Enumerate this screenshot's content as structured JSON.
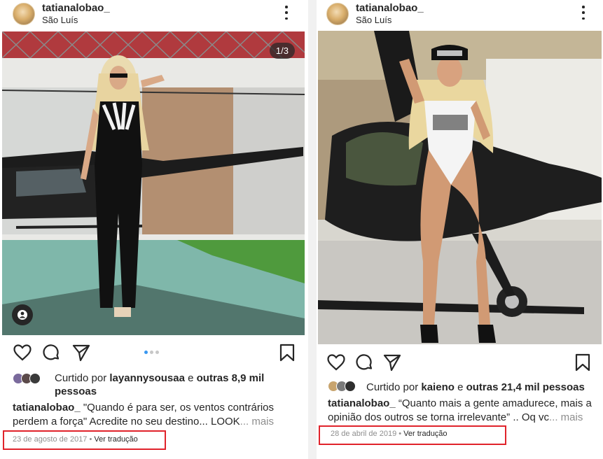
{
  "posts": [
    {
      "username": "tatianalobao_",
      "location": "São Luís",
      "image_counter": "1/3",
      "liked_by_prefix": "Curtido por",
      "liked_by_user": "layannysousaa",
      "liked_by_conj": "e",
      "liked_by_others": "outras 8,9 mil pessoas",
      "caption_user": "tatianalobao_",
      "caption_text": "\"Quando é para ser, os ventos contrários perdem a força\" Acredite no seu destino... LOOK",
      "caption_more": "... mais",
      "date": "23 de agosto de 2017",
      "separator": "•",
      "translate": "Ver tradução",
      "carousel_dots": 3,
      "active_dot": 0
    },
    {
      "username": "tatianalobao_",
      "location": "São Luís",
      "liked_by_prefix": "Curtido por",
      "liked_by_user": "kaieno",
      "liked_by_conj": "e",
      "liked_by_others": "outras 21,4 mil pessoas",
      "caption_user": "tatianalobao_",
      "caption_text": "“Quanto mais a gente amadurece, mais a opinião dos outros se torna irrelevante” .. Oq vc",
      "caption_more": "... mais",
      "date": "28 de abril de 2019",
      "separator": "•",
      "translate": "Ver tradução"
    }
  ],
  "icons": {
    "like": "heart-outline-icon",
    "comment": "comment-bubble-icon",
    "share": "paper-plane-icon",
    "save": "bookmark-icon",
    "options": "more-vertical-icon",
    "tag": "user-tag-icon"
  },
  "colors": {
    "highlight_box": "#e0232b",
    "active_dot": "#3897f0",
    "muted_text": "#8e8e8e"
  }
}
